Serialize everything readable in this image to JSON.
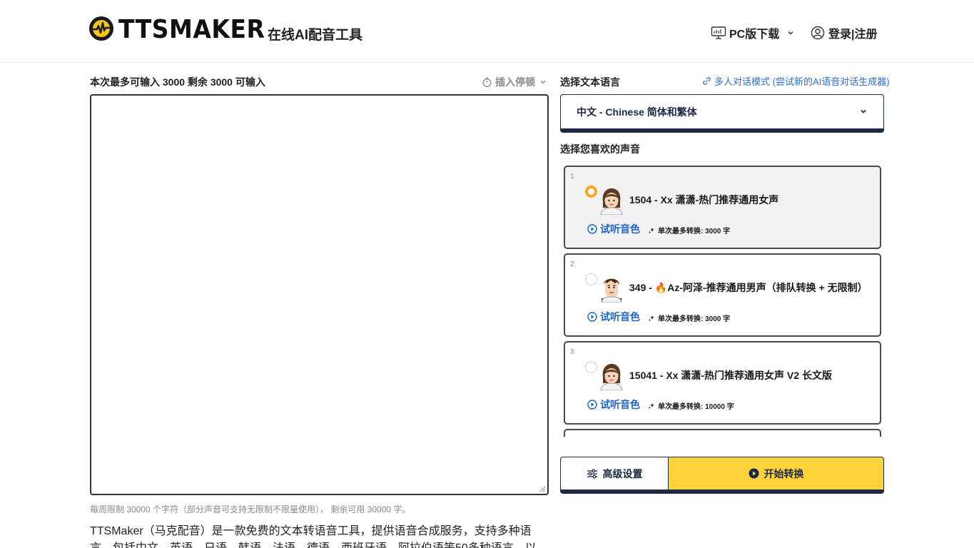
{
  "header": {
    "logo_text": "TTSMAKER",
    "tagline": "在线AI配音工具",
    "pc_download": "PC版下载",
    "login": "登录|注册"
  },
  "editor": {
    "limit_text": "本次最多可输入 3000 剩余 3000 可输入",
    "insert_pause": "插入停顿",
    "text_value": "",
    "weekly_note": "每周限制 30000 个字符（部分声音可支持无限制不限量使用）， 剩余可用 30000 字。",
    "intro": "TTSMaker（马克配音）是一款免费的文本转语音工具，提供语音合成服务，支持多种语言，包括中文、英语、日语、韩语、法语、德语、西班牙语、阿拉伯语等50多种语言，以及"
  },
  "language": {
    "label": "选择文本语言",
    "multi_link": "多人对话模式 (尝试新的AI语音对话生成器)",
    "selected": "中文 - Chinese 简体和繁体"
  },
  "voices": {
    "label": "选择您喜欢的声音",
    "listen_label": "试听音色",
    "items": [
      {
        "index": "1",
        "name": "1504 - Xx 潇潇-热门推荐通用女声",
        "max": "单次最多转换: 3000 字",
        "selected": true,
        "avatar": "female-avatar"
      },
      {
        "index": "2",
        "name": "349 - 🔥Az-阿泽-推荐通用男声（排队转换 + 无限制）",
        "max": "单次最多转换: 3000 字",
        "selected": false,
        "avatar": "male-avatar"
      },
      {
        "index": "3",
        "name": "15041 - Xx 潇潇-热门推荐通用女声 V2 长文版",
        "max": "单次最多转换: 10000 字",
        "selected": false,
        "avatar": "female-avatar"
      }
    ]
  },
  "actions": {
    "advanced": "高级设置",
    "start": "开始转换"
  },
  "colors": {
    "accent_yellow": "#fdd23a",
    "navy": "#1e2a44",
    "link_blue": "#1f64c8",
    "radio_orange": "#f5a623"
  }
}
